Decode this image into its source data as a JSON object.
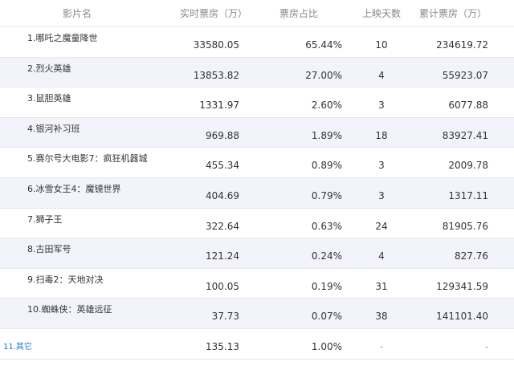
{
  "table": {
    "headers": [
      "影片名",
      "实时票房（万）",
      "票房占比",
      "上映天数",
      "累计票房（万）"
    ],
    "rows": [
      {
        "name": "1.哪吒之魔童降世",
        "realtime": "33580.05",
        "share": "65.44%",
        "days": "10",
        "total": "234619.72"
      },
      {
        "name": "2.烈火英雄",
        "realtime": "13853.82",
        "share": "27.00%",
        "days": "4",
        "total": "55923.07"
      },
      {
        "name": "3.鼠胆英雄",
        "realtime": "1331.97",
        "share": "2.60%",
        "days": "3",
        "total": "6077.88"
      },
      {
        "name": "4.银河补习班",
        "realtime": "969.88",
        "share": "1.89%",
        "days": "18",
        "total": "83927.41"
      },
      {
        "name": "5.赛尔号大电影7：疯狂机器城",
        "realtime": "455.34",
        "share": "0.89%",
        "days": "3",
        "total": "2009.78"
      },
      {
        "name": "6.冰雪女王4：魔镜世界",
        "realtime": "404.69",
        "share": "0.79%",
        "days": "3",
        "total": "1317.11"
      },
      {
        "name": "7.狮子王",
        "realtime": "322.64",
        "share": "0.63%",
        "days": "24",
        "total": "81905.76"
      },
      {
        "name": "8.古田军号",
        "realtime": "121.24",
        "share": "0.24%",
        "days": "4",
        "total": "827.76"
      },
      {
        "name": "9.扫毒2：天地对决",
        "realtime": "100.05",
        "share": "0.19%",
        "days": "31",
        "total": "129341.59"
      },
      {
        "name": "10.蜘蛛侠：英雄远征",
        "realtime": "37.73",
        "share": "0.07%",
        "days": "38",
        "total": "141101.40"
      },
      {
        "name": "11.其它",
        "realtime": "135.13",
        "share": "1.00%",
        "days": "-",
        "total": "-"
      }
    ]
  }
}
